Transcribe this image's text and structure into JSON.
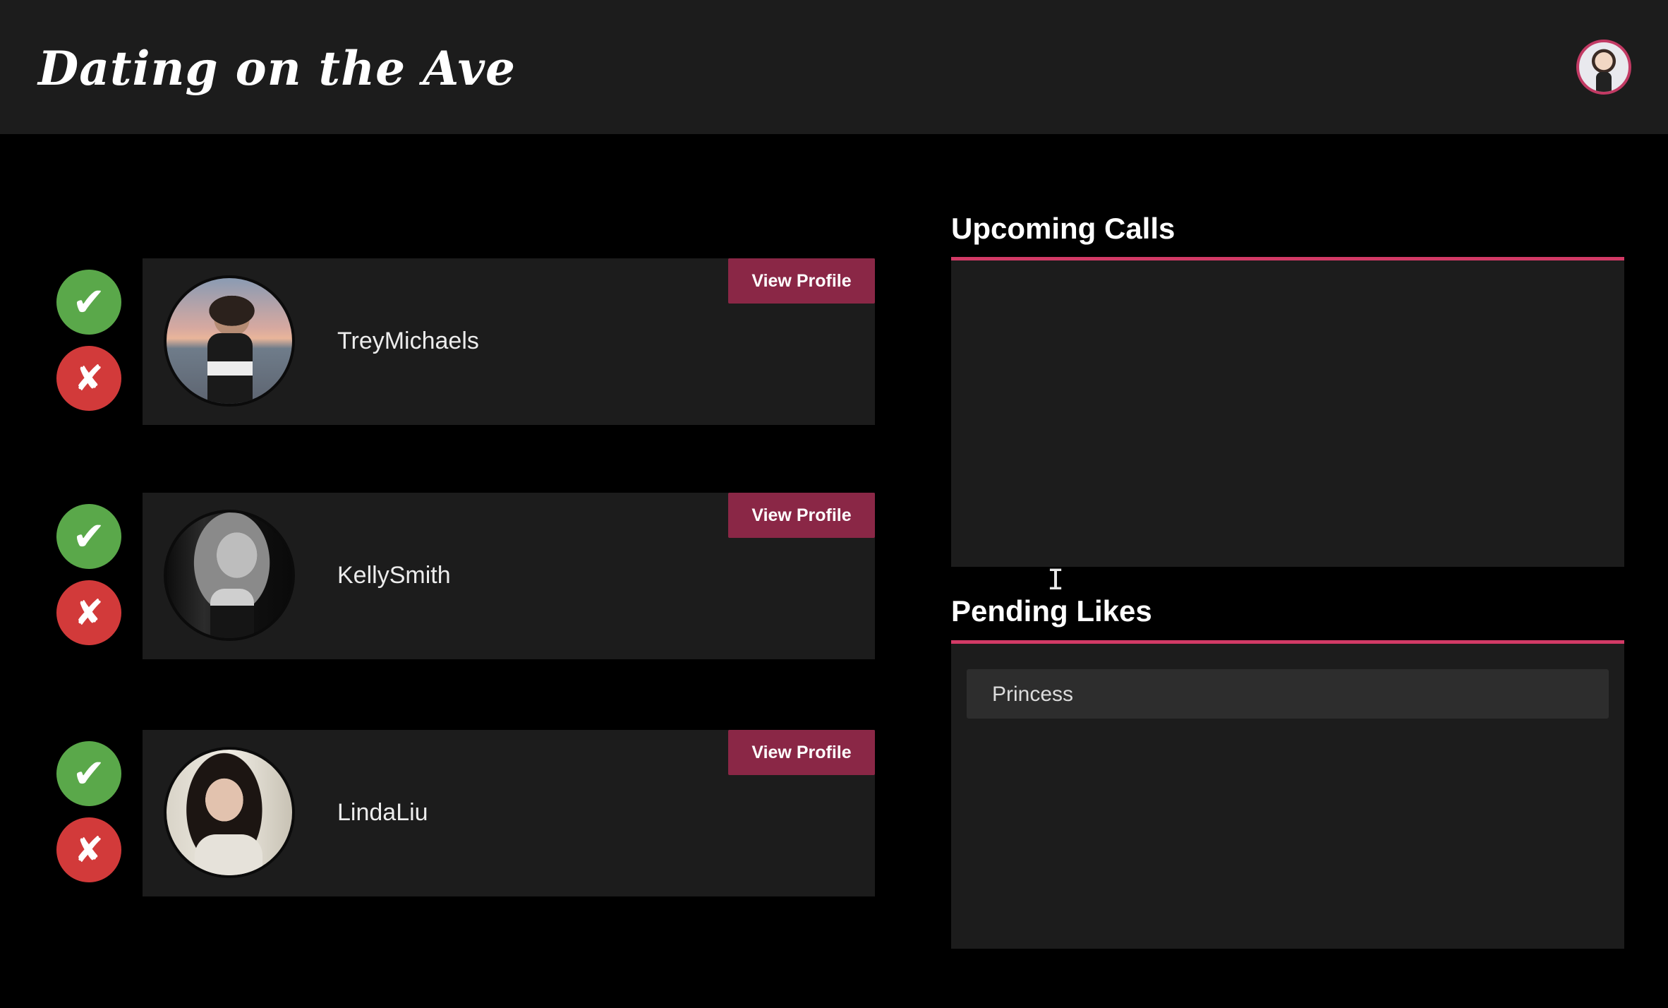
{
  "header": {
    "app_title": "Dating on the Ave",
    "profile_avatar_icon": "user-avatar-icon"
  },
  "matches": [
    {
      "name": "TreyMichaels",
      "view_profile_label": "View Profile",
      "accept_icon": "✔",
      "reject_icon": "✘"
    },
    {
      "name": "KellySmith",
      "view_profile_label": "View Profile",
      "accept_icon": "✔",
      "reject_icon": "✘"
    },
    {
      "name": "LindaLiu",
      "view_profile_label": "View Profile",
      "accept_icon": "✔",
      "reject_icon": "✘"
    }
  ],
  "upcoming_calls": {
    "title": "Upcoming Calls",
    "items": []
  },
  "pending_likes": {
    "title": "Pending Likes",
    "items": [
      {
        "label": "Princess"
      }
    ]
  },
  "colors": {
    "accent": "#d23a66",
    "view_profile_button": "#8a2746",
    "accept": "#5aa84a",
    "reject": "#d23a3a",
    "panel": "#1c1c1c",
    "background": "#000000"
  }
}
